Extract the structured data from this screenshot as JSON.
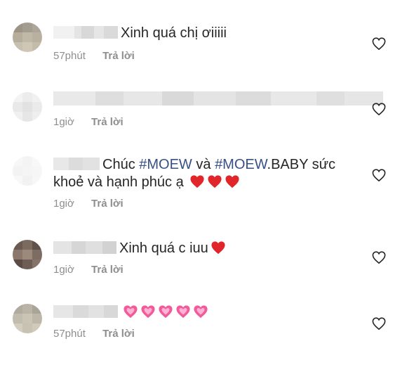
{
  "comments": [
    {
      "text": "Xinh quá chị ơiiiii",
      "time": "57phút",
      "reply": "Trả lời"
    },
    {
      "text": "",
      "time": "1giờ",
      "reply": "Trả lời"
    },
    {
      "text_prefix": "Chúc ",
      "tag1": "#MOEW",
      "mid": " và ",
      "tag2": "#MOEW",
      "after_tag2": ".BABY sức",
      "line2": "khoẻ và hạnh phúc ạ",
      "time": "1giờ",
      "reply": "Trả lời"
    },
    {
      "text": "Xinh quá c iuu",
      "time": "1giờ",
      "reply": "Trả lời"
    },
    {
      "text": "",
      "time": "57phút",
      "reply": "Trả lời"
    }
  ],
  "icons": {
    "like": "heart-outline-icon",
    "red_heart": "red-heart-emoji",
    "pink_heart": "sparkling-heart-emoji"
  },
  "colors": {
    "hashtag": "#385185",
    "meta": "#8e8e8e",
    "red_heart": "#e0262a",
    "pink_heart": "#f25a9b"
  }
}
